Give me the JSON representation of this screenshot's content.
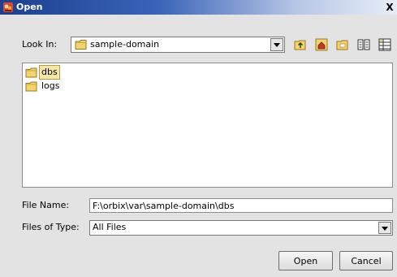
{
  "window": {
    "title": "Open",
    "icon": "app-icon",
    "close_label": "X"
  },
  "look_in": {
    "label": "Look In:",
    "value": "sample-domain",
    "icon": "folder-icon"
  },
  "toolbar": {
    "buttons": [
      {
        "name": "up-one-level-icon"
      },
      {
        "name": "home-icon"
      },
      {
        "name": "new-folder-icon"
      },
      {
        "name": "list-view-icon"
      },
      {
        "name": "details-view-icon"
      }
    ]
  },
  "file_list": {
    "items": [
      {
        "name": "dbs",
        "icon": "folder-icon",
        "selected": true
      },
      {
        "name": "logs",
        "icon": "folder-icon",
        "selected": false
      }
    ]
  },
  "file_name": {
    "label": "File Name:",
    "value": "F:\\orbix\\var\\sample-domain\\dbs"
  },
  "files_of_type": {
    "label": "Files of Type:",
    "value": "All Files"
  },
  "buttons": {
    "open_label": "Open",
    "cancel_label": "Cancel"
  },
  "colors": {
    "titlebar_start": "#1c3f8f",
    "titlebar_end": "#e8eef8",
    "dialog_bg": "#e3e3e3",
    "folder_yellow": "#f3d36b",
    "selection_bg": "#f7e7a7"
  }
}
